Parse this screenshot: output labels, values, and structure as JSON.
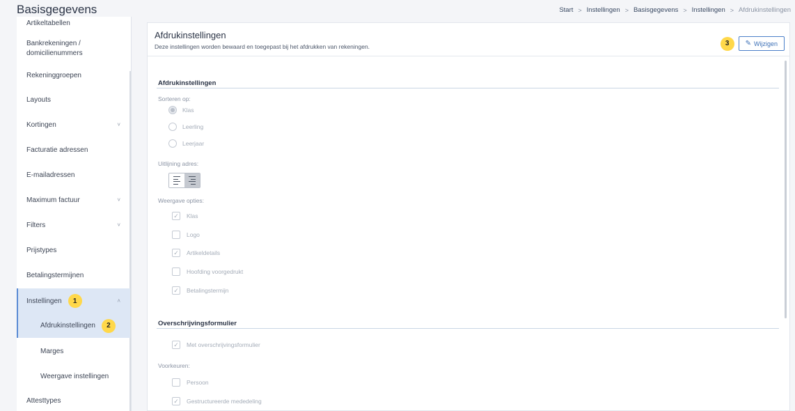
{
  "header": {
    "title": "Basisgegevens",
    "breadcrumb": [
      "Start",
      "Instellingen",
      "Basisgegevens",
      "Instellingen",
      "Afdrukinstellingen"
    ]
  },
  "sidebar": {
    "items": [
      {
        "label": "Artikeltabellen"
      },
      {
        "label": "Bankrekeningen /",
        "label2": "domicilienummers"
      },
      {
        "label": "Rekeninggroepen"
      },
      {
        "label": "Layouts"
      },
      {
        "label": "Kortingen",
        "chevron": "˅"
      },
      {
        "label": "Facturatie adressen"
      },
      {
        "label": "E-mailadressen"
      },
      {
        "label": "Maximum factuur",
        "chevron": "˅"
      },
      {
        "label": "Filters",
        "chevron": "˅"
      },
      {
        "label": "Prijstypes"
      },
      {
        "label": "Betalingstermijnen"
      },
      {
        "label": "Instellingen",
        "chevron": "˄",
        "badge": "1"
      },
      {
        "label": "Afdrukinstellingen",
        "badge": "2"
      },
      {
        "label": "Marges"
      },
      {
        "label": "Weergave instellingen"
      },
      {
        "label": "Attesttypes"
      }
    ]
  },
  "main": {
    "title": "Afdrukinstellingen",
    "subtitle": "Deze instellingen worden bewaard en toegepast bij het afdrukken van rekeningen.",
    "edit_badge": "3",
    "edit_label": "Wijzigen",
    "section1": {
      "title": "Afdrukinstellingen",
      "sort_label": "Sorteren op:",
      "sort_options": [
        "Klas",
        "Leerling",
        "Leerjaar"
      ],
      "selected_sort": "Klas",
      "align_label": "Uitlijning adres:",
      "align_selected": "right",
      "display_label": "Weergave opties:",
      "display_options": [
        {
          "label": "Klas",
          "checked": true
        },
        {
          "label": "Logo",
          "checked": false
        },
        {
          "label": "Artikeldetails",
          "checked": true
        },
        {
          "label": "Hoofding voorgedrukt",
          "checked": false
        },
        {
          "label": "Betalingstermijn",
          "checked": true
        }
      ]
    },
    "section2": {
      "title": "Overschrijvingsformulier",
      "with_form": {
        "label": "Met overschrijvingsformulier",
        "checked": true
      },
      "pref_label": "Voorkeuren:",
      "prefs": [
        {
          "label": "Persoon",
          "checked": false
        },
        {
          "label": "Gestructureerde mededeling",
          "checked": true
        }
      ]
    }
  }
}
